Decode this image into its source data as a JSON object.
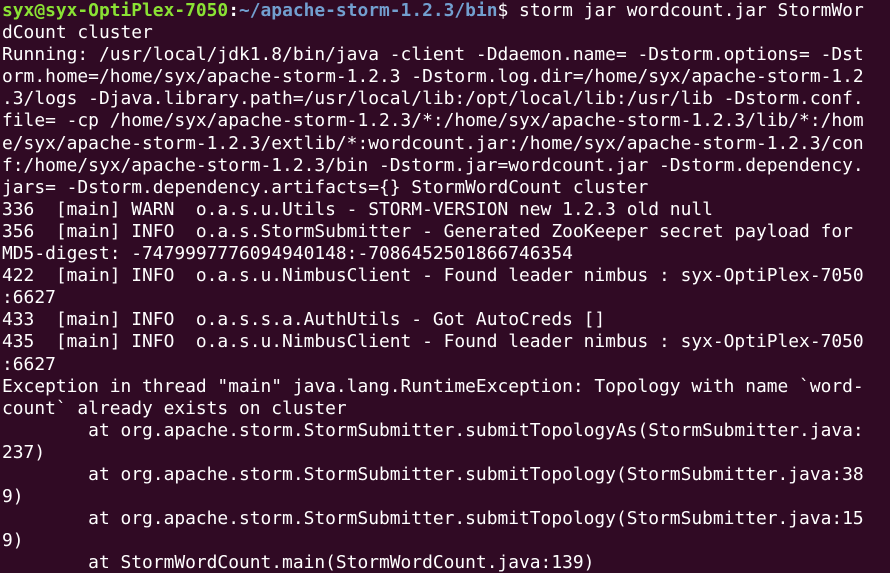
{
  "prompt": {
    "user_host": "syx@syx-OptiPlex-7050",
    "separator": ":",
    "path": "~/apache-storm-1.2.3/bin",
    "dollar": "$ ",
    "command_line1": "storm jar wordcount.jar StormWor",
    "command_line2": "dCount cluster"
  },
  "output_lines": [
    "Running: /usr/local/jdk1.8/bin/java -client -Ddaemon.name= -Dstorm.options= -Dst",
    "orm.home=/home/syx/apache-storm-1.2.3 -Dstorm.log.dir=/home/syx/apache-storm-1.2",
    ".3/logs -Djava.library.path=/usr/local/lib:/opt/local/lib:/usr/lib -Dstorm.conf.",
    "file= -cp /home/syx/apache-storm-1.2.3/*:/home/syx/apache-storm-1.2.3/lib/*:/hom",
    "e/syx/apache-storm-1.2.3/extlib/*:wordcount.jar:/home/syx/apache-storm-1.2.3/con",
    "f:/home/syx/apache-storm-1.2.3/bin -Dstorm.jar=wordcount.jar -Dstorm.dependency.",
    "jars= -Dstorm.dependency.artifacts={} StormWordCount cluster",
    "336  [main] WARN  o.a.s.u.Utils - STORM-VERSION new 1.2.3 old null",
    "356  [main] INFO  o.a.s.StormSubmitter - Generated ZooKeeper secret payload for",
    "MD5-digest: -7479997776094940148:-7086452501866746354",
    "422  [main] INFO  o.a.s.u.NimbusClient - Found leader nimbus : syx-OptiPlex-7050",
    ":6627",
    "433  [main] INFO  o.a.s.s.a.AuthUtils - Got AutoCreds []",
    "435  [main] INFO  o.a.s.u.NimbusClient - Found leader nimbus : syx-OptiPlex-7050",
    ":6627",
    "Exception in thread \"main\" java.lang.RuntimeException: Topology with name `word-",
    "count` already exists on cluster",
    "        at org.apache.storm.StormSubmitter.submitTopologyAs(StormSubmitter.java:",
    "237)",
    "        at org.apache.storm.StormSubmitter.submitTopology(StormSubmitter.java:38",
    "9)",
    "        at org.apache.storm.StormSubmitter.submitTopology(StormSubmitter.java:15",
    "9)",
    "        at StormWordCount.main(StormWordCount.java:139)"
  ],
  "colors": {
    "background": "#300a24",
    "text": "#ffffff",
    "prompt_user": "#8ae234",
    "prompt_path": "#729fcf"
  }
}
